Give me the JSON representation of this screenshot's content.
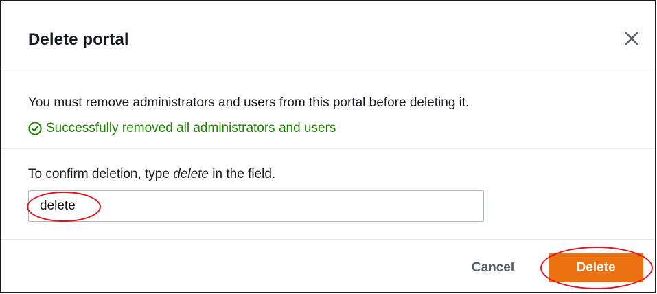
{
  "dialog": {
    "title": "Delete portal",
    "close_icon": "close-icon"
  },
  "body": {
    "message": "You must remove administrators and users from this portal before deleting it.",
    "success_icon": "check-circle-icon",
    "success_text": "Successfully removed all administrators and users"
  },
  "confirm": {
    "label_prefix": "To confirm deletion, type ",
    "label_keyword": "delete",
    "label_suffix": " in the field.",
    "input_value": "delete"
  },
  "footer": {
    "cancel_label": "Cancel",
    "delete_label": "Delete"
  },
  "colors": {
    "success": "#1d8102",
    "primary": "#ec7211",
    "annotation": "#e0141c"
  }
}
